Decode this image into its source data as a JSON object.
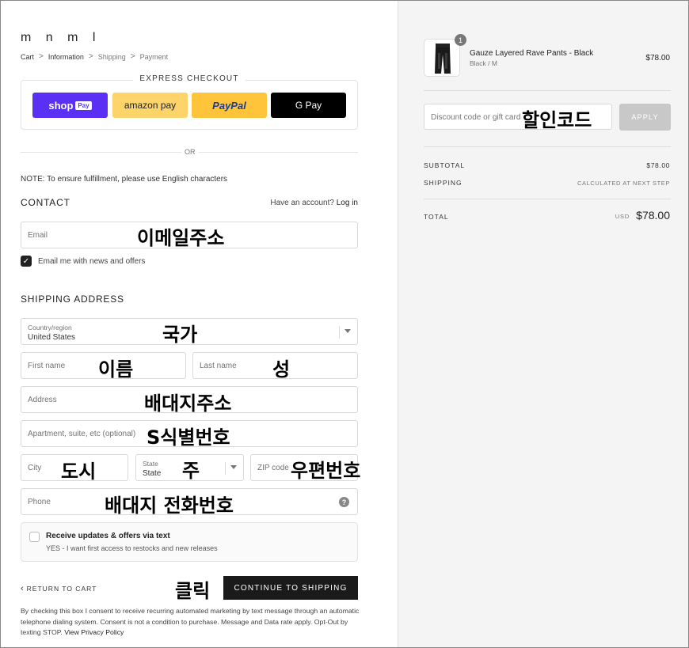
{
  "store": {
    "logo": "m n m l"
  },
  "breadcrumb": {
    "items": [
      "Cart",
      "Information",
      "Shipping",
      "Payment"
    ],
    "separator": ">"
  },
  "express_checkout": {
    "title": "EXPRESS CHECKOUT",
    "buttons": {
      "shop_pay": "shop",
      "shop_pay_badge": "Pay",
      "amazon_pay": "amazon pay",
      "paypal": "PayPal",
      "google_pay": "G Pay"
    },
    "or_label": "OR"
  },
  "note": "NOTE: To ensure fulfillment, please use English characters",
  "contact": {
    "title": "CONTACT",
    "account_prompt": "Have an account?",
    "login_link": "Log in",
    "email_placeholder": "Email",
    "email_annotation": "이메일주소",
    "newsletter_label": "Email me with news and offers",
    "newsletter_checked": true
  },
  "shipping": {
    "title": "SHIPPING ADDRESS",
    "country_label": "Country/region",
    "country_value": "United States",
    "country_annotation": "국가",
    "first_name_placeholder": "First name",
    "first_name_annotation": "이름",
    "last_name_placeholder": "Last name",
    "last_name_annotation": "성",
    "address_placeholder": "Address",
    "address_annotation": "배대지주소",
    "apartment_placeholder": "Apartment, suite, etc (optional)",
    "apartment_annotation": "S식별번호",
    "city_placeholder": "City",
    "city_annotation": "도시",
    "state_label": "State",
    "state_value": "State",
    "state_annotation": "주",
    "zip_placeholder": "ZIP code",
    "zip_annotation": "우편번호",
    "phone_placeholder": "Phone",
    "phone_annotation": "배대지 전화번호",
    "phone_help": "?"
  },
  "sms_optin": {
    "title": "Receive updates & offers via text",
    "subtitle": "YES - I want first access to restocks and new releases",
    "checked": false
  },
  "actions": {
    "return_label": "RETURN TO CART",
    "continue_label": "CONTINUE TO SHIPPING",
    "click_annotation": "클릭"
  },
  "legal": {
    "text": "By checking this box I consent to receive recurring automated marketing by text message through an automatic telephone dialing system. Consent is not a condition to purchase. Message and Data rate apply. Opt-Out by texting STOP.",
    "link": "View Privacy Policy"
  },
  "order_summary": {
    "product": {
      "name": "Gauze Layered Rave Pants - Black",
      "variant": "Black / M",
      "price": "$78.00",
      "quantity": "1"
    },
    "discount_placeholder": "Discount code or gift card",
    "discount_annotation": "할인코드",
    "apply_label": "APPLY",
    "subtotal_label": "SUBTOTAL",
    "subtotal_value": "$78.00",
    "shipping_label": "SHIPPING",
    "shipping_value": "CALCULATED AT NEXT STEP",
    "total_label": "TOTAL",
    "total_currency": "USD",
    "total_value": "$78.00"
  }
}
